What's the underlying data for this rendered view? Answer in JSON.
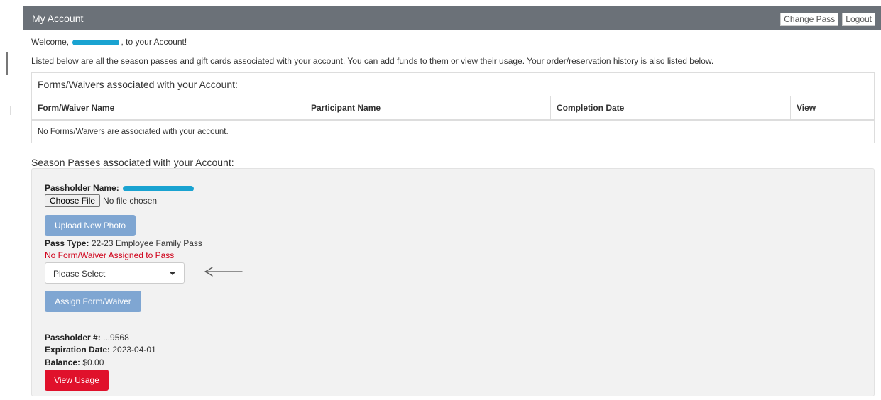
{
  "header": {
    "title": "My Account",
    "change_pass_label": "Change Pass",
    "logout_label": "Logout"
  },
  "welcome": {
    "prefix": "Welcome,",
    "suffix": ", to your Account!"
  },
  "intro_text": "Listed below are all the season passes and gift cards associated with your account. You can add funds to them or view their usage. Your order/reservation history is also listed below.",
  "forms_section": {
    "title": "Forms/Waivers associated with your Account:",
    "columns": [
      "Form/Waiver Name",
      "Participant Name",
      "Completion Date",
      "View"
    ],
    "empty_message": "No Forms/Waivers are associated with your account."
  },
  "season_section": {
    "title": "Season Passes associated with your Account:",
    "passholder_name_label": "Passholder Name:",
    "choose_file_label": "Choose File",
    "no_file_text": "No file chosen",
    "upload_button": "Upload New Photo",
    "pass_type_label": "Pass Type:",
    "pass_type_value": "22-23 Employee Family Pass",
    "no_form_warning": "No Form/Waiver Assigned to Pass",
    "select_value": "Please Select",
    "assign_button": "Assign Form/Waiver",
    "passholder_num_label": "Passholder #:",
    "passholder_num_value": "...9568",
    "expiration_label": "Expiration Date:",
    "expiration_value": "2023-04-01",
    "balance_label": "Balance:",
    "balance_value": "$0.00",
    "view_usage_button": "View Usage"
  },
  "colors": {
    "header_bg": "#6b7178",
    "redaction": "#1aa3d1",
    "primary_button": "#7fa6d2",
    "danger_button": "#e0112b",
    "warning_text": "#d0021b"
  }
}
